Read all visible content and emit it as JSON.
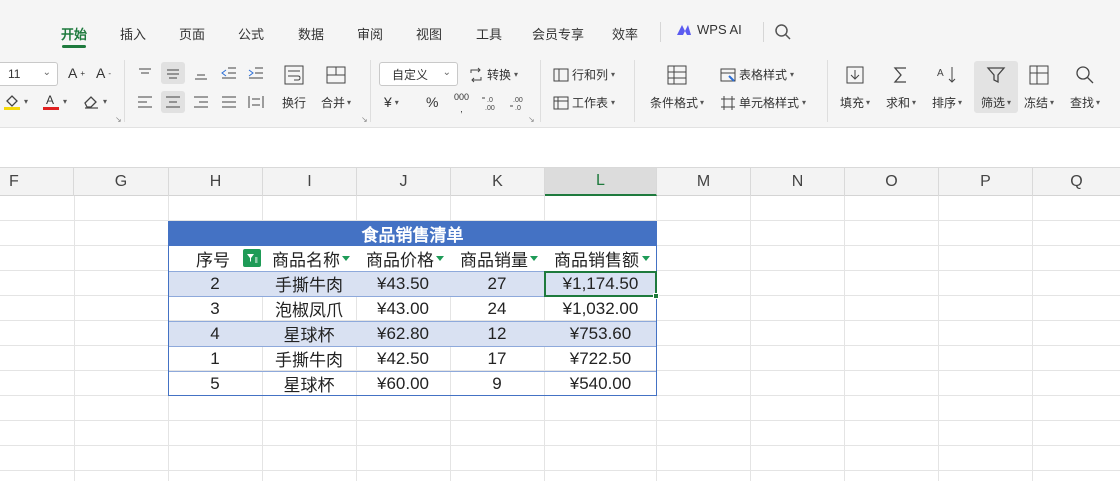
{
  "menu": {
    "tabs": [
      "开始",
      "插入",
      "页面",
      "公式",
      "数据",
      "审阅",
      "视图",
      "工具",
      "会员专享",
      "效率"
    ],
    "active_tab": "开始",
    "wps_ai": "WPS AI"
  },
  "ribbon": {
    "font_size": "11",
    "number_format": "自定义",
    "convert": "转换",
    "rows_cols": "行和列",
    "worksheet": "工作表",
    "wrap": "换行",
    "merge": "合并",
    "currency_symbol": "¥",
    "percent_symbol": "%",
    "thousands_symbol": "000",
    "conditional_format": "条件格式",
    "table_style": "表格样式",
    "cell_style": "单元格样式",
    "fill": "填充",
    "sum": "求和",
    "sort": "排序",
    "filter": "筛选",
    "freeze": "冻结",
    "find": "查找"
  },
  "columns": [
    "F",
    "G",
    "H",
    "I",
    "J",
    "K",
    "L",
    "M",
    "N",
    "O",
    "P",
    "Q"
  ],
  "selected_column": "L",
  "table": {
    "title": "食品销售清单",
    "headers": [
      "序号",
      "商品名称",
      "商品价格",
      "商品销量",
      "商品销售额"
    ],
    "rows": [
      [
        "2",
        "手撕牛肉",
        "¥43.50",
        "27",
        "¥1,174.50"
      ],
      [
        "3",
        "泡椒凤爪",
        "¥43.00",
        "24",
        "¥1,032.00"
      ],
      [
        "4",
        "星球杯",
        "¥62.80",
        "12",
        "¥753.60"
      ],
      [
        "1",
        "手撕牛肉",
        "¥42.50",
        "17",
        "¥722.50"
      ],
      [
        "5",
        "星球杯",
        "¥60.00",
        "9",
        "¥540.00"
      ]
    ]
  },
  "colors": {
    "accent_green": "#1e7a3d",
    "table_header_blue": "#4472c4",
    "table_band": "#d9e1f2"
  }
}
